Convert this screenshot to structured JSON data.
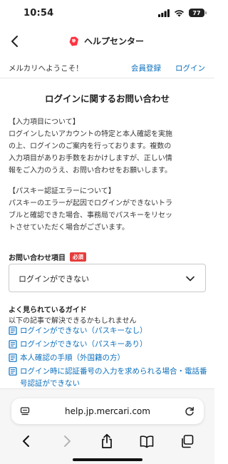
{
  "status_bar": {
    "time": "10:54",
    "battery": "77"
  },
  "nav": {
    "title": "ヘルプセンター"
  },
  "welcome": {
    "text": "メルカリへようこそ！",
    "register": "会員登録",
    "login": "ログイン"
  },
  "main": {
    "title": "ログインに関するお問い合わせ",
    "section1": {
      "heading": "【入力項目について】",
      "lines": [
        "ログインしたいアカウントの特定と本人確認を実施",
        "の上、ログインのご案内を行っております。複数の",
        "入力項目がありお手数をおかけしますが、正しい情",
        "報をご入力のうえ、お問い合わせをお願いします。"
      ]
    },
    "section2": {
      "heading": "【パスキー認証エラーについて】",
      "lines": [
        "パスキーのエラーが起因でログインができないトラ",
        "ブルと確認できた場合、事務局でパスキーをリセッ",
        "トさせていただく場合がございます。"
      ]
    }
  },
  "form": {
    "label": "お問い合わせ項目",
    "required_badge": "必須",
    "select_value": "ログインができない"
  },
  "guide": {
    "title": "よく見られているガイド",
    "subtitle": "以下の記事で解決できるかもしれません",
    "items": [
      {
        "label": "ログインができない（パスキーなし）"
      },
      {
        "label": "ログインができない（パスキーあり）"
      },
      {
        "label": "本人確認の手順（外国籍の方）"
      },
      {
        "label": "ログイン時に認証番号の入力を求められる場合・電話番号認証ができない"
      }
    ]
  },
  "browser": {
    "url": "help.jp.mercari.com"
  },
  "colors": {
    "link": "#0b6fbd",
    "badge": "#e63c3c",
    "brand": "#ff333f"
  }
}
